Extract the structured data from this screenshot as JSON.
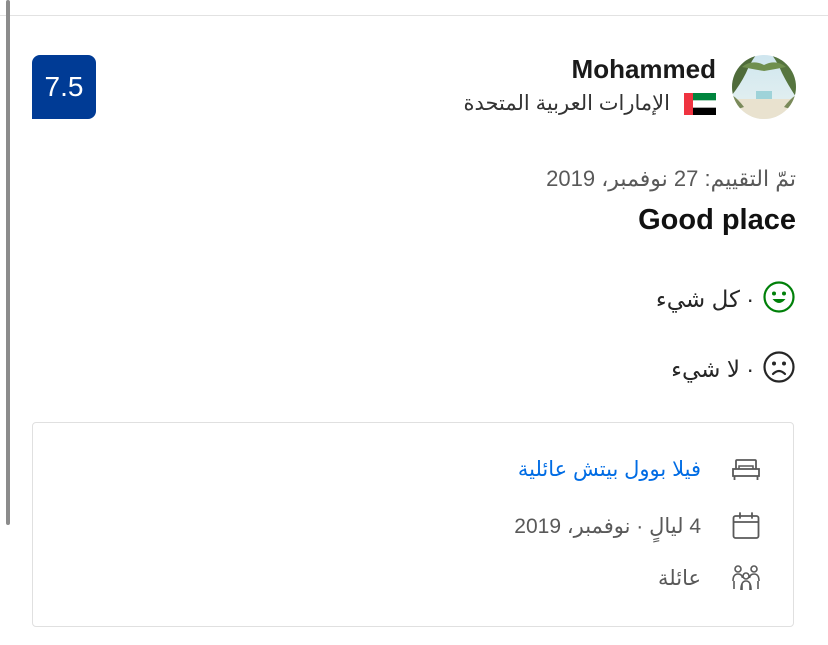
{
  "review": {
    "score": "7.5",
    "reviewer": {
      "name": "Mohammed",
      "country": "الإمارات العربية المتحدة"
    },
    "date": "تمّ التقييم: 27 نوفمبر، 2019",
    "title": "Good place",
    "positive": "· كل شيء",
    "negative": "· لا شيء"
  },
  "stay": {
    "room": "فيلا بوول بيتش عائلية",
    "nights_date": "4 ليالٍ · نوفمبر، 2019",
    "traveler_type": "عائلة"
  },
  "icons": {
    "positive": "smiley-face-icon",
    "negative": "sad-face-icon",
    "room": "bed-icon",
    "date": "calendar-icon",
    "traveler": "group-people-icon",
    "flag": "uae-flag-icon"
  },
  "colors": {
    "score_badge": "#003b95",
    "link": "#006ce4",
    "positive_icon": "#008009",
    "negative_icon": "#262626"
  }
}
